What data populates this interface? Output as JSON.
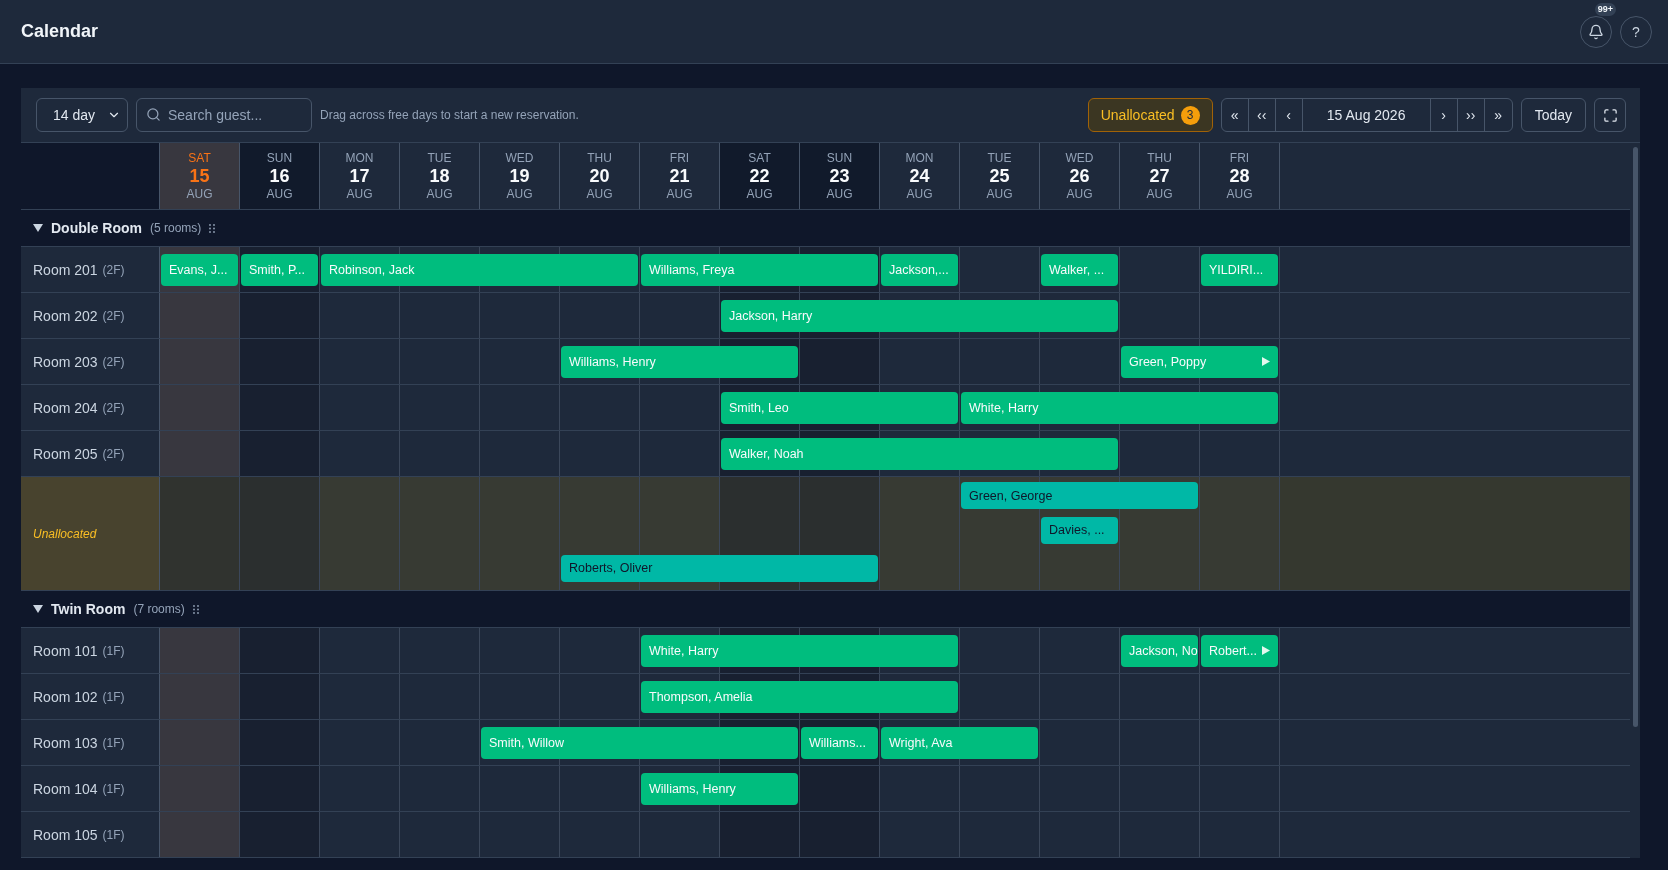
{
  "app_header": {
    "title": "Calendar",
    "notification_badge": "99+",
    "help_button": "?"
  },
  "toolbar": {
    "range_select": "14 day",
    "search": {
      "placeholder": "Search guest..."
    },
    "hint": "Drag across free days to start a new reservation.",
    "unallocated_button": {
      "label": "Unallocated",
      "count": "3"
    },
    "nav_buttons": [
      "«",
      "‹‹",
      "‹"
    ],
    "date": "15 Aug 2026",
    "nav_buttons_after": [
      "›",
      "››",
      "»"
    ],
    "today_button": "Today"
  },
  "calendar": {
    "days": [
      {
        "weekday": "SAT",
        "day": "15",
        "month": "AUG",
        "today": true,
        "weekend": true
      },
      {
        "weekday": "SUN",
        "day": "16",
        "month": "AUG",
        "today": false,
        "weekend": true
      },
      {
        "weekday": "MON",
        "day": "17",
        "month": "AUG",
        "today": false,
        "weekend": false
      },
      {
        "weekday": "TUE",
        "day": "18",
        "month": "AUG",
        "today": false,
        "weekend": false
      },
      {
        "weekday": "WED",
        "day": "19",
        "month": "AUG",
        "today": false,
        "weekend": false
      },
      {
        "weekday": "THU",
        "day": "20",
        "month": "AUG",
        "today": false,
        "weekend": false
      },
      {
        "weekday": "FRI",
        "day": "21",
        "month": "AUG",
        "today": false,
        "weekend": false
      },
      {
        "weekday": "SAT",
        "day": "22",
        "month": "AUG",
        "today": false,
        "weekend": true
      },
      {
        "weekday": "SUN",
        "day": "23",
        "month": "AUG",
        "today": false,
        "weekend": true
      },
      {
        "weekday": "MON",
        "day": "24",
        "month": "AUG",
        "today": false,
        "weekend": false
      },
      {
        "weekday": "TUE",
        "day": "25",
        "month": "AUG",
        "today": false,
        "weekend": false
      },
      {
        "weekday": "WED",
        "day": "26",
        "month": "AUG",
        "today": false,
        "weekend": false
      },
      {
        "weekday": "THU",
        "day": "27",
        "month": "AUG",
        "today": false,
        "weekend": false
      },
      {
        "weekday": "FRI",
        "day": "28",
        "month": "AUG",
        "today": false,
        "weekend": false
      }
    ],
    "groups": [
      {
        "name": "Double Room",
        "count": "(5 rooms)",
        "expanded": true,
        "rooms": [
          {
            "name": "Room 201",
            "floor": "(2F)",
            "bookings": [
              {
                "guest": "Evans, J...",
                "kind": "allocated",
                "continues": false
              },
              {
                "guest": "Smith, P...",
                "kind": "allocated",
                "continues": false
              },
              {
                "guest": "Robinson, Jack",
                "kind": "allocated",
                "continues": false
              },
              {
                "guest": "Williams, Freya",
                "kind": "allocated",
                "continues": false
              },
              {
                "guest": "Jackson,...",
                "kind": "allocated",
                "continues": false
              },
              {
                "guest": "Walker, ...",
                "kind": "allocated",
                "continues": false
              },
              {
                "guest": "YILDIRI...",
                "kind": "allocated",
                "continues": false
              }
            ]
          },
          {
            "name": "Room 202",
            "floor": "(2F)",
            "bookings": [
              {
                "guest": "Jackson, Harry",
                "kind": "allocated",
                "continues": false
              }
            ]
          },
          {
            "name": "Room 203",
            "floor": "(2F)",
            "bookings": [
              {
                "guest": "Williams, Henry",
                "kind": "allocated",
                "continues": false
              },
              {
                "guest": "Green, Poppy",
                "kind": "allocated",
                "continues": true
              }
            ]
          },
          {
            "name": "Room 204",
            "floor": "(2F)",
            "bookings": [
              {
                "guest": "Smith, Leo",
                "kind": "allocated",
                "continues": false
              },
              {
                "guest": "White, Harry",
                "kind": "allocated",
                "continues": false
              }
            ]
          },
          {
            "name": "Room 205",
            "floor": "(2F)",
            "bookings": [
              {
                "guest": "Walker, Noah",
                "kind": "allocated",
                "continues": false
              }
            ]
          }
        ],
        "unallocated": {
          "label": "Unallocated",
          "bookings": [
            {
              "guest": "Green, George",
              "kind": "unallocated",
              "continues": false
            },
            {
              "guest": "Davies, ...",
              "kind": "unallocated",
              "continues": false
            },
            {
              "guest": "Roberts, Oliver",
              "kind": "unallocated",
              "continues": false
            }
          ]
        }
      },
      {
        "name": "Twin Room",
        "count": "(7 rooms)",
        "expanded": true,
        "rooms": [
          {
            "name": "Room 101",
            "floor": "(1F)",
            "bookings": [
              {
                "guest": "White, Harry",
                "kind": "allocated",
                "continues": false
              },
              {
                "guest": "Jackson, No",
                "kind": "allocated",
                "continues": false
              },
              {
                "guest": "Robert...",
                "kind": "allocated",
                "continues": true
              }
            ]
          },
          {
            "name": "Room 102",
            "floor": "(1F)",
            "bookings": [
              {
                "guest": "Thompson, Amelia",
                "kind": "allocated",
                "continues": false
              }
            ]
          },
          {
            "name": "Room 103",
            "floor": "(1F)",
            "bookings": [
              {
                "guest": "Smith, Willow",
                "kind": "allocated",
                "continues": false
              },
              {
                "guest": "Williams...",
                "kind": "allocated",
                "continues": false
              },
              {
                "guest": "Wright, Ava",
                "kind": "allocated",
                "continues": false
              }
            ]
          },
          {
            "name": "Room 104",
            "floor": "(1F)",
            "bookings": [
              {
                "guest": "Williams, Henry",
                "kind": "allocated",
                "continues": false
              }
            ]
          },
          {
            "name": "Room 105",
            "floor": "(1F)"
          }
        ]
      }
    ]
  }
}
